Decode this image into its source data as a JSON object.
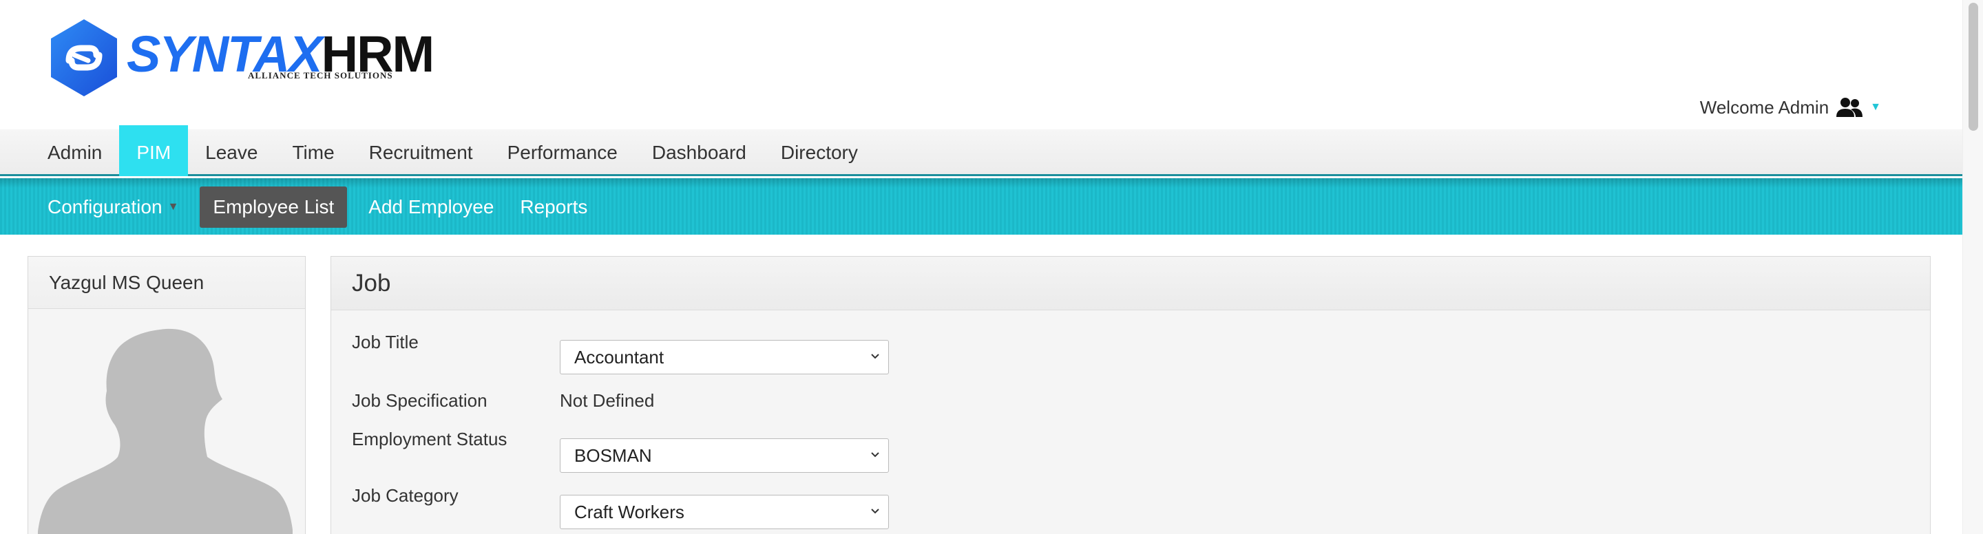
{
  "brand": {
    "name_part1": "SYNTAX",
    "name_part2": "HRM",
    "tagline": "ALLIANCE TECH SOLUTIONS",
    "colors": {
      "primary": "#1e6ef0",
      "accent": "#21c5d6"
    }
  },
  "user": {
    "welcome": "Welcome Admin",
    "icon": "users-icon"
  },
  "main_nav": {
    "items": [
      {
        "label": "Admin",
        "active": false
      },
      {
        "label": "PIM",
        "active": true
      },
      {
        "label": "Leave",
        "active": false
      },
      {
        "label": "Time",
        "active": false
      },
      {
        "label": "Recruitment",
        "active": false
      },
      {
        "label": "Performance",
        "active": false
      },
      {
        "label": "Dashboard",
        "active": false
      },
      {
        "label": "Directory",
        "active": false
      }
    ]
  },
  "sub_nav": {
    "items": [
      {
        "label": "Configuration",
        "has_dropdown": true,
        "active": false
      },
      {
        "label": "Employee List",
        "active": true
      },
      {
        "label": "Add Employee",
        "active": false
      },
      {
        "label": "Reports",
        "active": false
      }
    ]
  },
  "profile": {
    "name": "Yazgul MS Queen",
    "photo_icon": "person-silhouette-icon"
  },
  "job": {
    "title": "Job",
    "fields": {
      "job_title": {
        "label": "Job Title",
        "value": "Accountant"
      },
      "job_specification": {
        "label": "Job Specification",
        "value": "Not Defined"
      },
      "employment_status": {
        "label": "Employment Status",
        "value": "BOSMAN"
      },
      "job_category": {
        "label": "Job Category",
        "value": "Craft Workers"
      }
    }
  }
}
